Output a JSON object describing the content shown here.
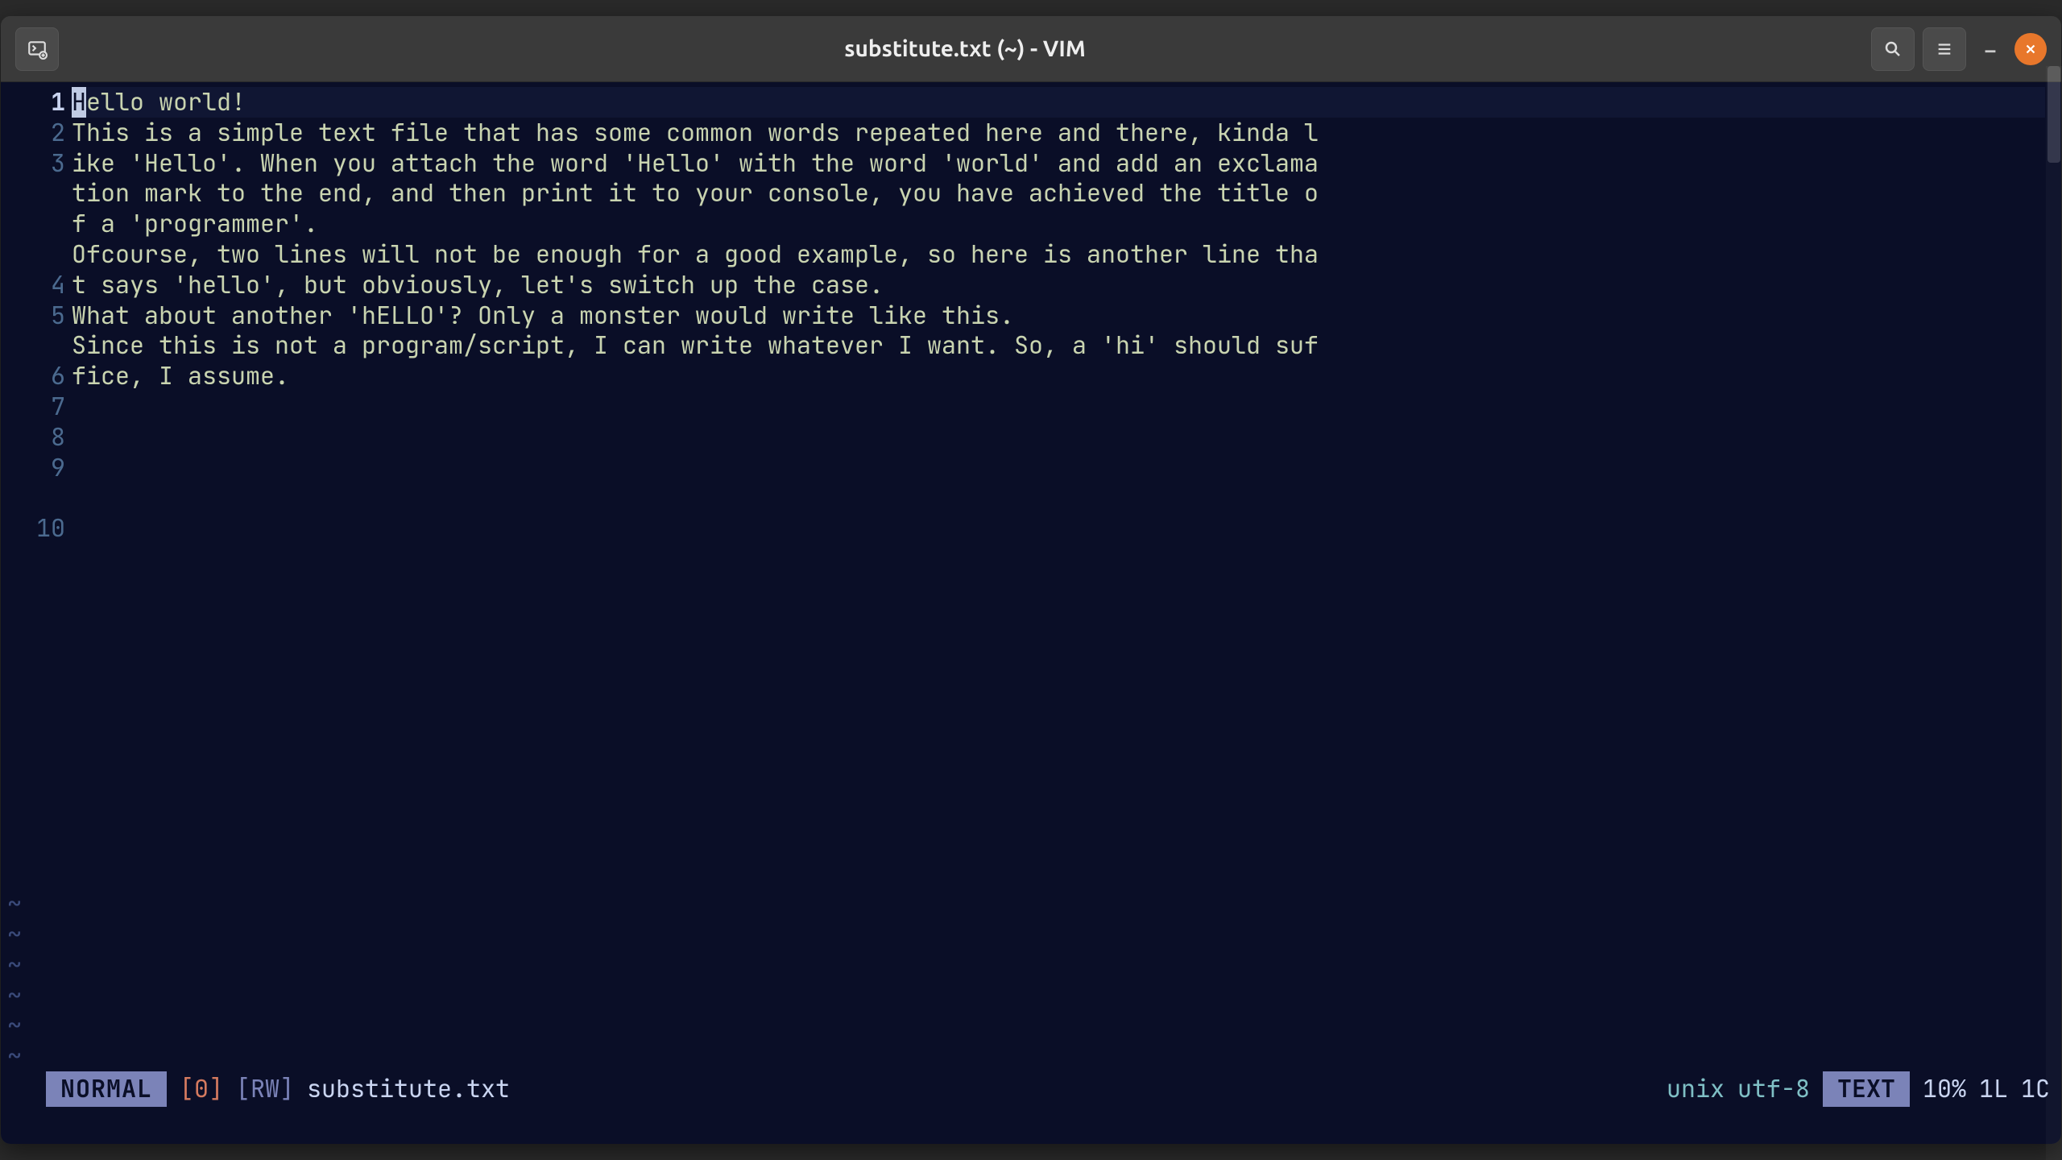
{
  "window": {
    "title": "substitute.txt (~) - VIM"
  },
  "file": {
    "name": "substitute.txt",
    "lines": [
      "Hello world!",
      "",
      "This is a simple text file that has some common words repeated here and there, kinda like 'Hello'. When you attach the word 'Hello' with the word 'world' and add an exclamation mark to the end, and then print it to your console, you have achieved the title of a 'programmer'.",
      "",
      "Ofcourse, two lines will not be enough for a good example, so here is another line that says 'hello', but obviously, let's switch up the case.",
      "",
      "What about another 'hELLO'? Only a monster would write like this.",
      "",
      "Since this is not a program/script, I can write whatever I want. So, a 'hi' should suffice, I assume.",
      ""
    ],
    "cursor_line": 1,
    "cursor_col": 1
  },
  "status": {
    "mode": "NORMAL",
    "bufnr": "[0]",
    "rw": "[RW]",
    "filename": "substitute.txt",
    "fileformat": "unix",
    "encoding": "utf-8",
    "filetype": "TEXT",
    "percent": "10%",
    "line": "1L",
    "col": "1C"
  },
  "tilde": "~",
  "line_numbers": [
    "1",
    "2",
    "3",
    "4",
    "5",
    "6",
    "7",
    "8",
    "9",
    "10"
  ]
}
